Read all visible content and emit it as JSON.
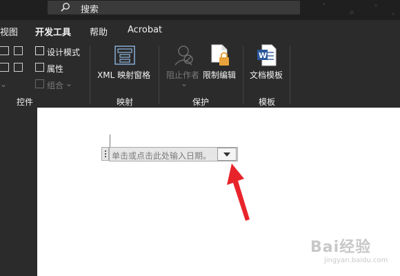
{
  "search": {
    "label": "搜索"
  },
  "tabs": [
    {
      "label": "视图",
      "active": false
    },
    {
      "label": "开发工具",
      "active": true
    },
    {
      "label": "帮助",
      "active": false
    },
    {
      "label": "Acrobat",
      "active": false
    }
  ],
  "ribbon": {
    "controls": {
      "design_mode": "设计模式",
      "properties": "属性",
      "group": "组合",
      "group_label": "控件"
    },
    "mapping": {
      "xml_pane": "XML 映射窗格",
      "group_label": "映射"
    },
    "protect": {
      "block_authors": "阻止作者",
      "restrict_editing": "限制编辑",
      "group_label": "保护"
    },
    "templates": {
      "document_template": "文档模板",
      "group_label": "模板"
    }
  },
  "document": {
    "date_placeholder": "单击或点击此处输入日期。"
  },
  "watermark": {
    "logo": "Bai经验",
    "url": "jingyan.baidu.com"
  },
  "colors": {
    "ribbon_bg": "#2b2b2b",
    "titlebar_bg": "#1f1f1f",
    "arrow": "#e8242b",
    "word_blue": "#2b579a",
    "lock_gold": "#e8a33b"
  },
  "icons": [
    "search-icon",
    "xml-pane-icon",
    "block-authors-icon",
    "restrict-editing-icon",
    "document-template-icon",
    "dropdown-arrow-icon"
  ]
}
